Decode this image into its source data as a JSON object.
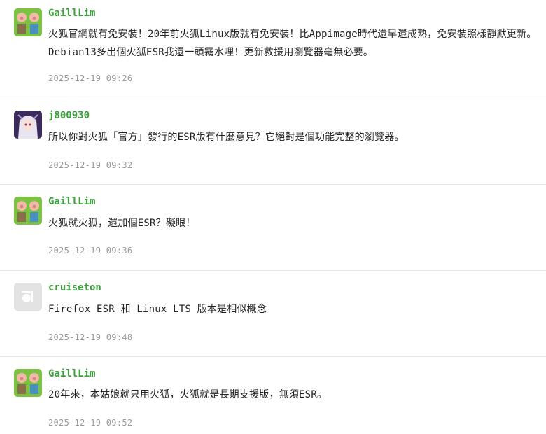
{
  "comments": [
    {
      "author": "GaillLim",
      "avatar": "pigs-avatar",
      "text": "火狐官網就有免安裝！20年前火狐Linux版就有免安裝！比Appimage時代還早還成熟，免安裝照樣靜默更新。Debian13多出個火狐ESR我還一頭霧水哩！更新救援用瀏覽器毫無必要。",
      "time": "2025-12-19 09:26"
    },
    {
      "author": "j800930",
      "avatar": "anime-girl-avatar",
      "text": "所以你對火狐「官方」發行的ESR版有什麼意見？它絕對是個功能完整的瀏覽器。",
      "time": "2025-12-19 09:32"
    },
    {
      "author": "GaillLim",
      "avatar": "pigs-avatar",
      "text": "火狐就火狐，還加個ESR？礙眼！",
      "time": "2025-12-19 09:36"
    },
    {
      "author": "cruiseton",
      "avatar": "default-avatar",
      "text": "Firefox ESR 和 Linux LTS 版本是相似概念",
      "time": "2025-12-19 09:48"
    },
    {
      "author": "GaillLim",
      "avatar": "pigs-avatar",
      "text": "20年來，本姑娘就只用火狐，火狐就是長期支援版，無須ESR。",
      "time": "2025-12-19 09:52"
    }
  ]
}
